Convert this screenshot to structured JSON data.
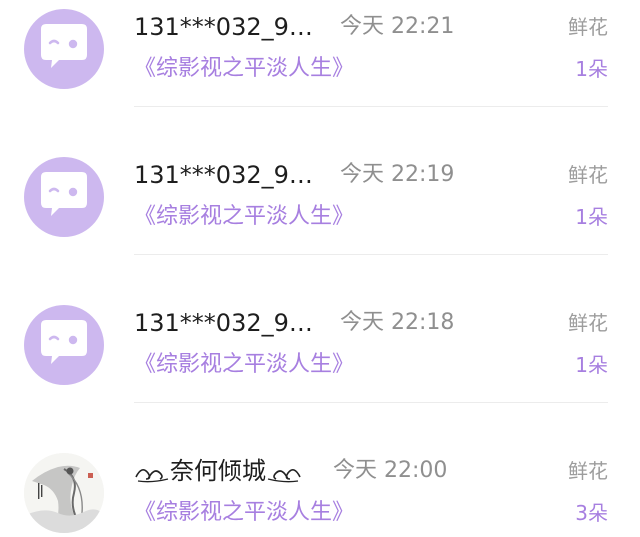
{
  "messages": [
    {
      "avatar_icon": "smile-chat-bubble-icon",
      "user": "131***032_9…",
      "time": "今天 22:21",
      "title": "《综影视之平淡人生》",
      "gift": "鲜花",
      "count": "1朵"
    },
    {
      "avatar_icon": "smile-chat-bubble-icon",
      "user": "131***032_9…",
      "time": "今天 22:19",
      "title": "《综影视之平淡人生》",
      "gift": "鲜花",
      "count": "1朵"
    },
    {
      "avatar_icon": "smile-chat-bubble-icon",
      "user": "131***032_9…",
      "time": "今天 22:18",
      "title": "《综影视之平淡人生》",
      "gift": "鲜花",
      "count": "1朵"
    },
    {
      "avatar_icon": "ink-painting-avatar",
      "user": "奈何倾城",
      "time": "今天 22:00",
      "title": "《综影视之平淡人生》",
      "gift": "鲜花",
      "count": "3朵"
    }
  ],
  "colors": {
    "accent": "#a77fe0",
    "avatar_bg": "#cdb8ef",
    "muted": "#8f8f8f"
  }
}
